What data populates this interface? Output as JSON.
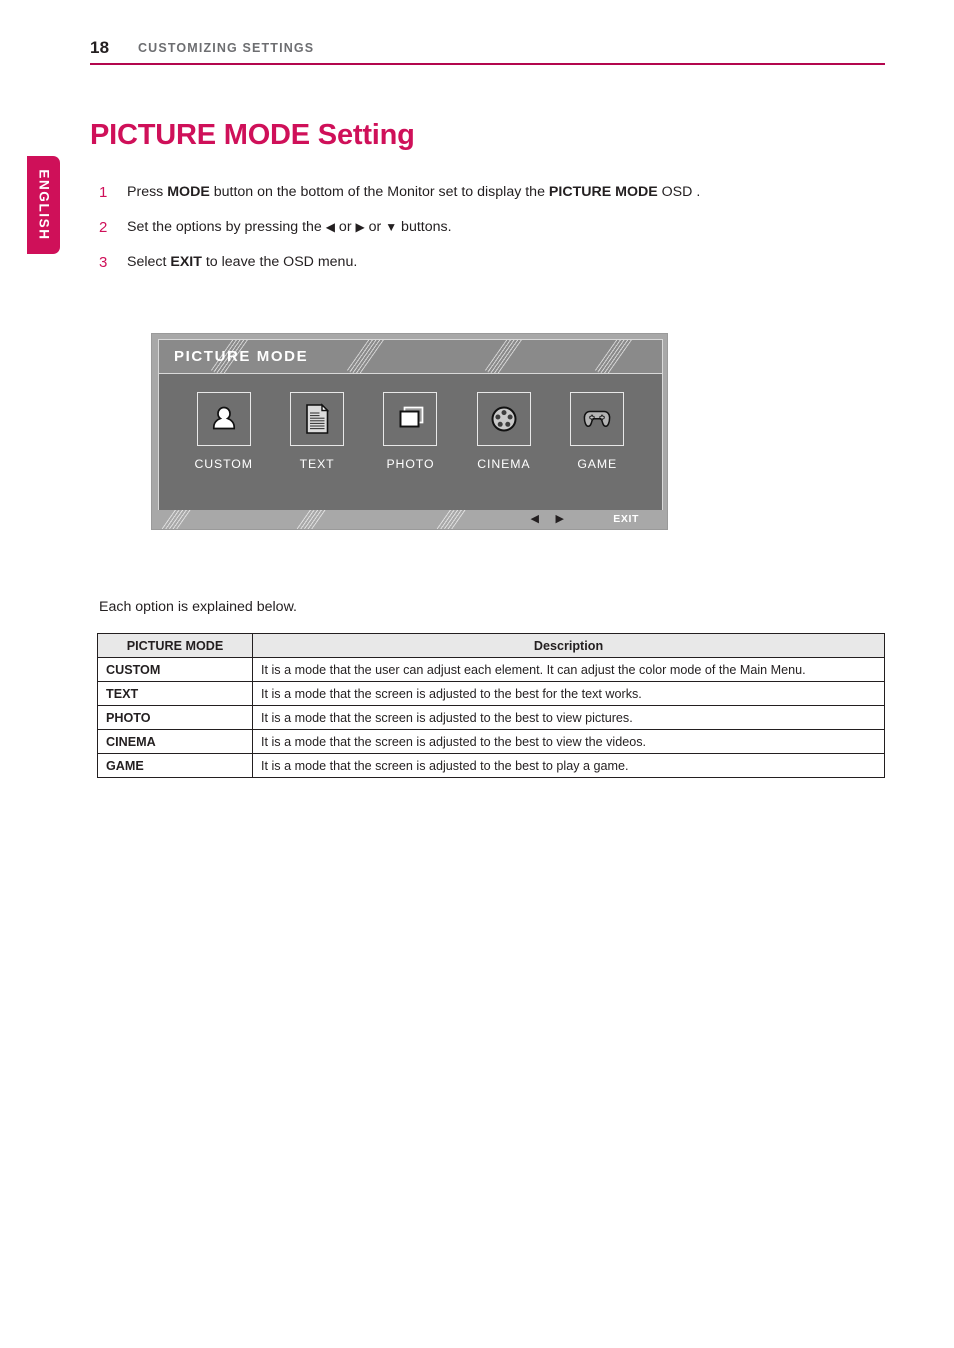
{
  "header": {
    "page_number": "18",
    "section_title": "CUSTOMIZING SETTINGS",
    "rule_color": "#b3064e"
  },
  "language_tab": {
    "label": "ENGLISH",
    "color": "#cf1059"
  },
  "title": {
    "text": "PICTURE MODE Setting",
    "color": "#cf1059"
  },
  "steps": [
    {
      "number": "1",
      "parts": [
        {
          "t": "Press ",
          "b": false
        },
        {
          "t": "MODE",
          "b": true
        },
        {
          "t": " button on the bottom of the Monitor set to display the ",
          "b": false
        },
        {
          "t": "PICTURE MODE",
          "b": true
        },
        {
          "t": " OSD .",
          "b": false
        }
      ]
    },
    {
      "number": "2",
      "parts": [
        {
          "t": "Set the options by pressing the ",
          "b": false
        },
        {
          "t": "◀",
          "b": false
        },
        {
          "t": " or ",
          "b": false
        },
        {
          "t": "▶",
          "b": false
        },
        {
          "t": " or ",
          "b": false
        },
        {
          "t": "▼",
          "b": false
        },
        {
          "t": " buttons.",
          "b": false
        }
      ]
    },
    {
      "number": "3",
      "parts": [
        {
          "t": "Select ",
          "b": false
        },
        {
          "t": "EXIT",
          "b": true
        },
        {
          "t": " to leave the OSD menu.",
          "b": false
        }
      ]
    }
  ],
  "osd": {
    "title": "PICTURE  MODE",
    "modes": [
      {
        "label": "CUSTOM",
        "icon": "person-icon"
      },
      {
        "label": "TEXT",
        "icon": "document-icon"
      },
      {
        "label": "PHOTO",
        "icon": "pictures-icon"
      },
      {
        "label": "CINEMA",
        "icon": "film-reel-icon"
      },
      {
        "label": "GAME",
        "icon": "gamepad-icon"
      }
    ],
    "footer": {
      "nav_left": "◀",
      "nav_right": "▶",
      "exit": "EXIT"
    }
  },
  "lead_text": "Each option is explained below.",
  "table": {
    "headers": [
      "PICTURE MODE",
      "Description"
    ],
    "rows": [
      {
        "mode": "CUSTOM",
        "description": "It is a mode that the user can adjust each element. It can adjust the color mode of the Main Menu."
      },
      {
        "mode": "TEXT",
        "description": "It is a mode that the screen is adjusted to the best for the text works."
      },
      {
        "mode": "PHOTO",
        "description": "It is a mode that the screen is adjusted to the best to view pictures."
      },
      {
        "mode": "CINEMA",
        "description": "It is a mode that the screen is adjusted to the best to view the videos."
      },
      {
        "mode": "GAME",
        "description": "It is a mode that the screen is adjusted to the best to play a game."
      }
    ]
  }
}
